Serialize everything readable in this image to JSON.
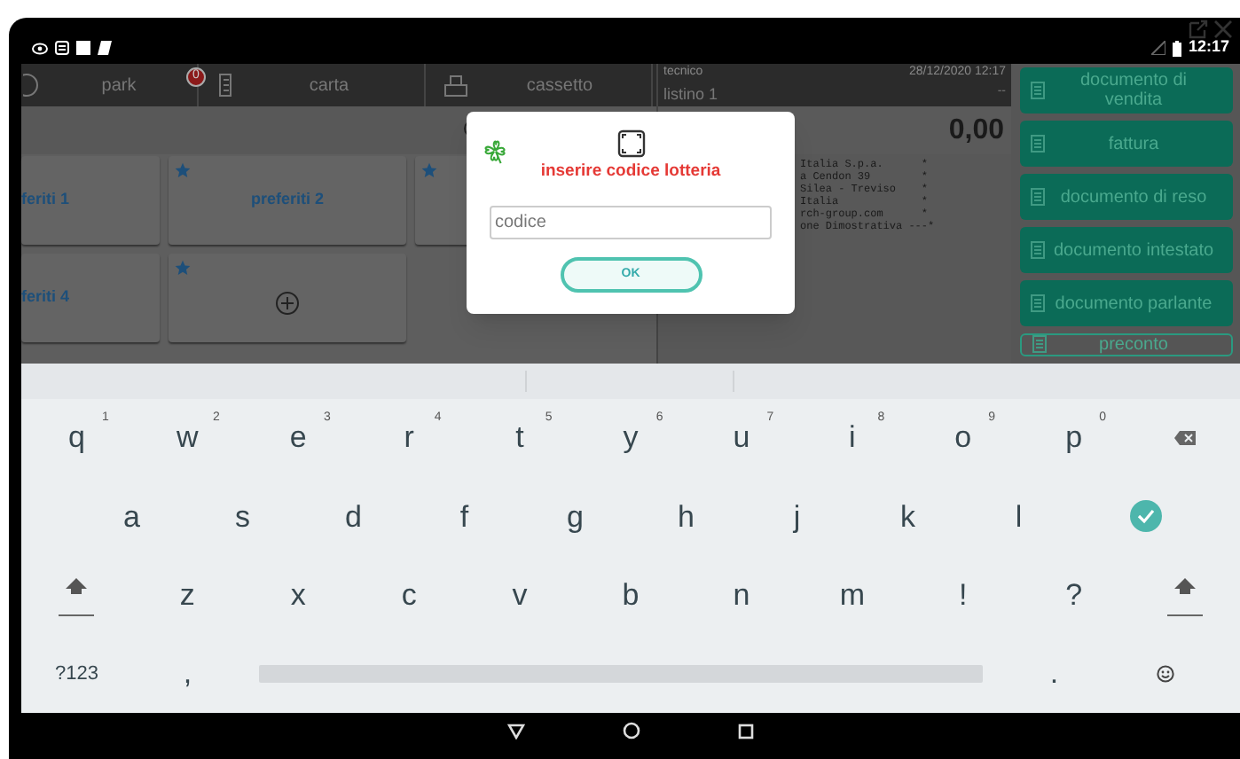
{
  "status_bar": {
    "time": "12:17"
  },
  "tabs": [
    {
      "label": "park",
      "badge": "0"
    },
    {
      "label": "carta"
    },
    {
      "label": "cassetto"
    }
  ],
  "header": {
    "operator": "tecnico",
    "datetime": "28/12/2020 12:17",
    "price_list": "listino 1",
    "column_4": "--"
  },
  "favorites": [
    {
      "kind": "tile",
      "label": "feriti 1",
      "starred": false
    },
    {
      "kind": "tile",
      "label": "preferiti 2",
      "starred": true
    },
    {
      "kind": "tile",
      "starred": true
    },
    {
      "kind": "tile",
      "label": "feriti 4",
      "starred": false
    },
    {
      "kind": "add",
      "starred": true
    }
  ],
  "total": "0,00",
  "receipt_lines": [
    "Italia S.p.a.      *",
    "a Cendon 39        *",
    "Silea - Treviso    *",
    "Italia             *",
    "rch-group.com      *",
    "one Dimostrativa ---*"
  ],
  "actions": [
    {
      "label": "documento di vendita"
    },
    {
      "label": "fattura"
    },
    {
      "label": "documento di reso"
    },
    {
      "label": "documento intestato"
    },
    {
      "label": "documento parlante"
    },
    {
      "label": "preconto"
    }
  ],
  "dialog": {
    "title": "inserire codice lotteria",
    "placeholder": "codice",
    "button": "OK"
  },
  "keyboard": {
    "rows": [
      [
        {
          "kind": "char",
          "label": "q",
          "hint": "1"
        },
        {
          "kind": "char",
          "label": "w",
          "hint": "2"
        },
        {
          "kind": "char",
          "label": "e",
          "hint": "3"
        },
        {
          "kind": "char",
          "label": "r",
          "hint": "4"
        },
        {
          "kind": "char",
          "label": "t",
          "hint": "5"
        },
        {
          "kind": "char",
          "label": "y",
          "hint": "6"
        },
        {
          "kind": "char",
          "label": "u",
          "hint": "7"
        },
        {
          "kind": "char",
          "label": "i",
          "hint": "8"
        },
        {
          "kind": "char",
          "label": "o",
          "hint": "9"
        },
        {
          "kind": "char",
          "label": "p",
          "hint": "0"
        },
        {
          "kind": "backspace"
        }
      ],
      [
        {
          "kind": "char",
          "label": "a"
        },
        {
          "kind": "char",
          "label": "s"
        },
        {
          "kind": "char",
          "label": "d"
        },
        {
          "kind": "char",
          "label": "f"
        },
        {
          "kind": "char",
          "label": "g"
        },
        {
          "kind": "char",
          "label": "h"
        },
        {
          "kind": "char",
          "label": "j"
        },
        {
          "kind": "char",
          "label": "k"
        },
        {
          "kind": "char",
          "label": "l"
        },
        {
          "kind": "enter"
        }
      ],
      [
        {
          "kind": "shift"
        },
        {
          "kind": "char",
          "label": "z"
        },
        {
          "kind": "char",
          "label": "x"
        },
        {
          "kind": "char",
          "label": "c"
        },
        {
          "kind": "char",
          "label": "v"
        },
        {
          "kind": "char",
          "label": "b"
        },
        {
          "kind": "char",
          "label": "n"
        },
        {
          "kind": "char",
          "label": "m"
        },
        {
          "kind": "char",
          "label": "!"
        },
        {
          "kind": "char",
          "label": "?"
        },
        {
          "kind": "shift"
        }
      ],
      [
        {
          "kind": "char",
          "label": "?123"
        },
        {
          "kind": "char",
          "label": ","
        },
        {
          "kind": "space"
        },
        {
          "kind": "char",
          "label": "."
        },
        {
          "kind": "emoji"
        }
      ]
    ]
  }
}
